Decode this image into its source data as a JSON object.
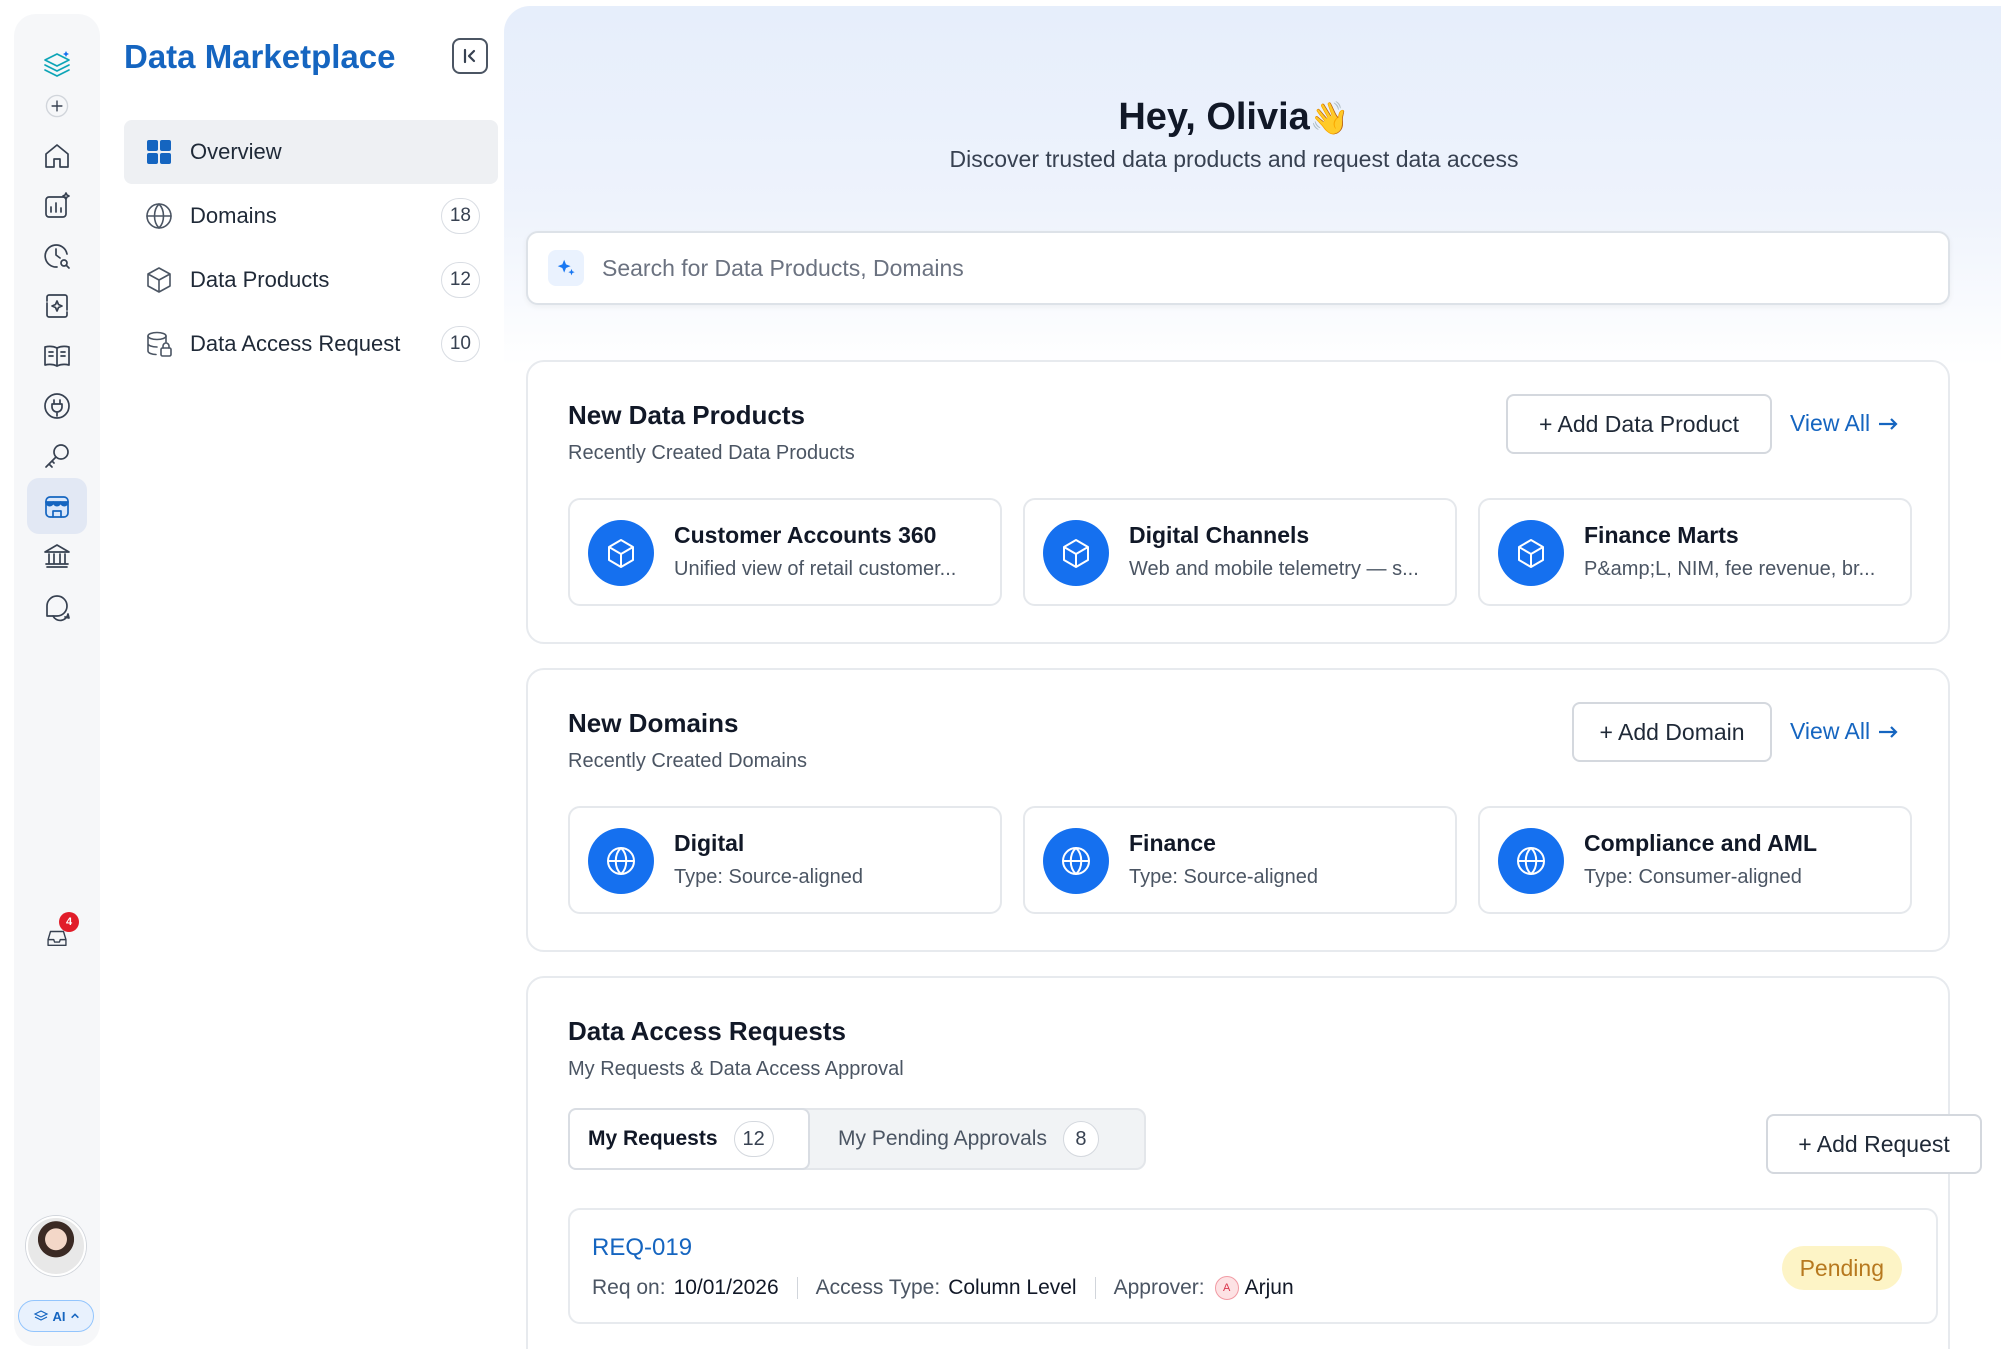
{
  "sidebar": {
    "title": "Data Marketplace",
    "items": [
      {
        "label": "Overview",
        "count": null,
        "icon": "grid-icon"
      },
      {
        "label": "Domains",
        "count": "18",
        "icon": "globe-icon"
      },
      {
        "label": "Data Products",
        "count": "12",
        "icon": "cube-icon"
      },
      {
        "label": "Data Access Request",
        "count": "10",
        "icon": "database-lock-icon"
      }
    ]
  },
  "rail": {
    "inbox_badge": "4",
    "ai_label": "AI"
  },
  "header": {
    "greeting": "Hey, Olivia",
    "wave_emoji": "👋",
    "subtitle": "Discover trusted data products and request data access"
  },
  "search": {
    "placeholder": "Search for Data Products, Domains"
  },
  "data_products": {
    "title": "New Data Products",
    "subtitle": "Recently Created Data Products",
    "add_label": "+ Add Data Product",
    "view_all_label": "View All",
    "cards": [
      {
        "title": "Customer Accounts 360",
        "desc": "Unified view of retail customer..."
      },
      {
        "title": "Digital Channels",
        "desc": "Web and mobile telemetry — s..."
      },
      {
        "title": "Finance Marts",
        "desc": "P&amp;L, NIM, fee revenue, br..."
      }
    ]
  },
  "domains": {
    "title": "New Domains",
    "subtitle": "Recently Created Domains",
    "add_label": "+ Add Domain",
    "view_all_label": "View All",
    "cards": [
      {
        "title": "Digital",
        "desc": "Type: Source-aligned"
      },
      {
        "title": "Finance",
        "desc": "Type: Source-aligned"
      },
      {
        "title": "Compliance and AML",
        "desc": "Type: Consumer-aligned"
      }
    ]
  },
  "access_requests": {
    "title": "Data Access Requests",
    "subtitle": "My Requests & Data Access Approval",
    "add_label": "+ Add Request",
    "tabs": [
      {
        "label": "My Requests",
        "count": "12"
      },
      {
        "label": "My Pending Approvals",
        "count": "8"
      }
    ],
    "request": {
      "id": "REQ-019",
      "req_on_label": "Req on:",
      "req_on": "10/01/2026",
      "access_type_label": "Access Type:",
      "access_type": "Column Level",
      "approver_label": "Approver:",
      "approver_initial": "A",
      "approver": "Arjun",
      "status": "Pending"
    }
  },
  "colors": {
    "accent": "#1565c0",
    "icon_fill": "#1570ef",
    "pending_bg": "#fdf4c6",
    "pending_text": "#b7791f"
  }
}
